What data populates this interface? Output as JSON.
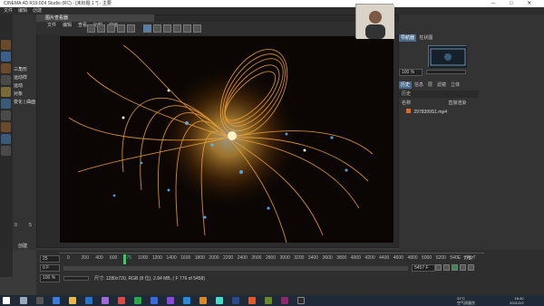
{
  "app": {
    "title": "CINEMA 4D R19.024 Studio (RC) - [未标题 1 *] - 主要",
    "menu": [
      "文件",
      "编辑",
      "创建",
      "选择",
      "工具",
      "网格",
      "捕捉",
      "动画",
      "模拟",
      "渲染",
      "雕刻",
      "运动跟踪",
      "运动图形",
      "角色",
      "流水线",
      "插件",
      "脚本",
      "窗口",
      "帮助"
    ]
  },
  "picture_viewer": {
    "title": "图片查看器",
    "menu": [
      "文件",
      "编辑",
      "查看",
      "比较",
      "动画"
    ],
    "start_frame": "25",
    "current_frame": "0 F",
    "end_frame": "7757",
    "total_field": "5457 F",
    "zoom": "100 %",
    "status": "尺寸: 1280x720, RGB (8 位), 2.84 MB, ( F 776 of 5458)",
    "ruler_ticks": [
      "0",
      "200",
      "400",
      "600",
      "775",
      "1000",
      "1200",
      "1400",
      "1600",
      "1800",
      "2000",
      "2200",
      "2400",
      "2600",
      "2800",
      "3000",
      "3200",
      "3400",
      "3600",
      "3800",
      "4000",
      "4200",
      "4400",
      "4600",
      "4800",
      "5000",
      "5200",
      "540E",
      "775 7"
    ],
    "playhead_value": "775"
  },
  "object_panel": {
    "items": [
      "三角形",
      "运动样",
      "运动",
      "对象",
      "变化 | 曲面"
    ]
  },
  "right_panel": {
    "tabs_top": [
      "导航器",
      "柱状图"
    ],
    "nav_zoom": "100 %",
    "tabs_history": [
      "历史",
      "信息",
      "层",
      "滤镜",
      "立体"
    ],
    "history_header": "历史",
    "columns": [
      "名称",
      "直接渲染"
    ],
    "file": "2978399S1.mp4"
  },
  "left_bottom": {
    "field_a": "0",
    "field_b": "5",
    "label_create": "创建",
    "label_edit": "编辑"
  },
  "taskbar": {
    "tray": "31°C\n空气质量良",
    "time": "16:40",
    "date": "2021/2/2"
  },
  "colors": {
    "accent_green": "#3ac96a",
    "glow": "#ffb347",
    "taskbar": "#1e2a38"
  }
}
